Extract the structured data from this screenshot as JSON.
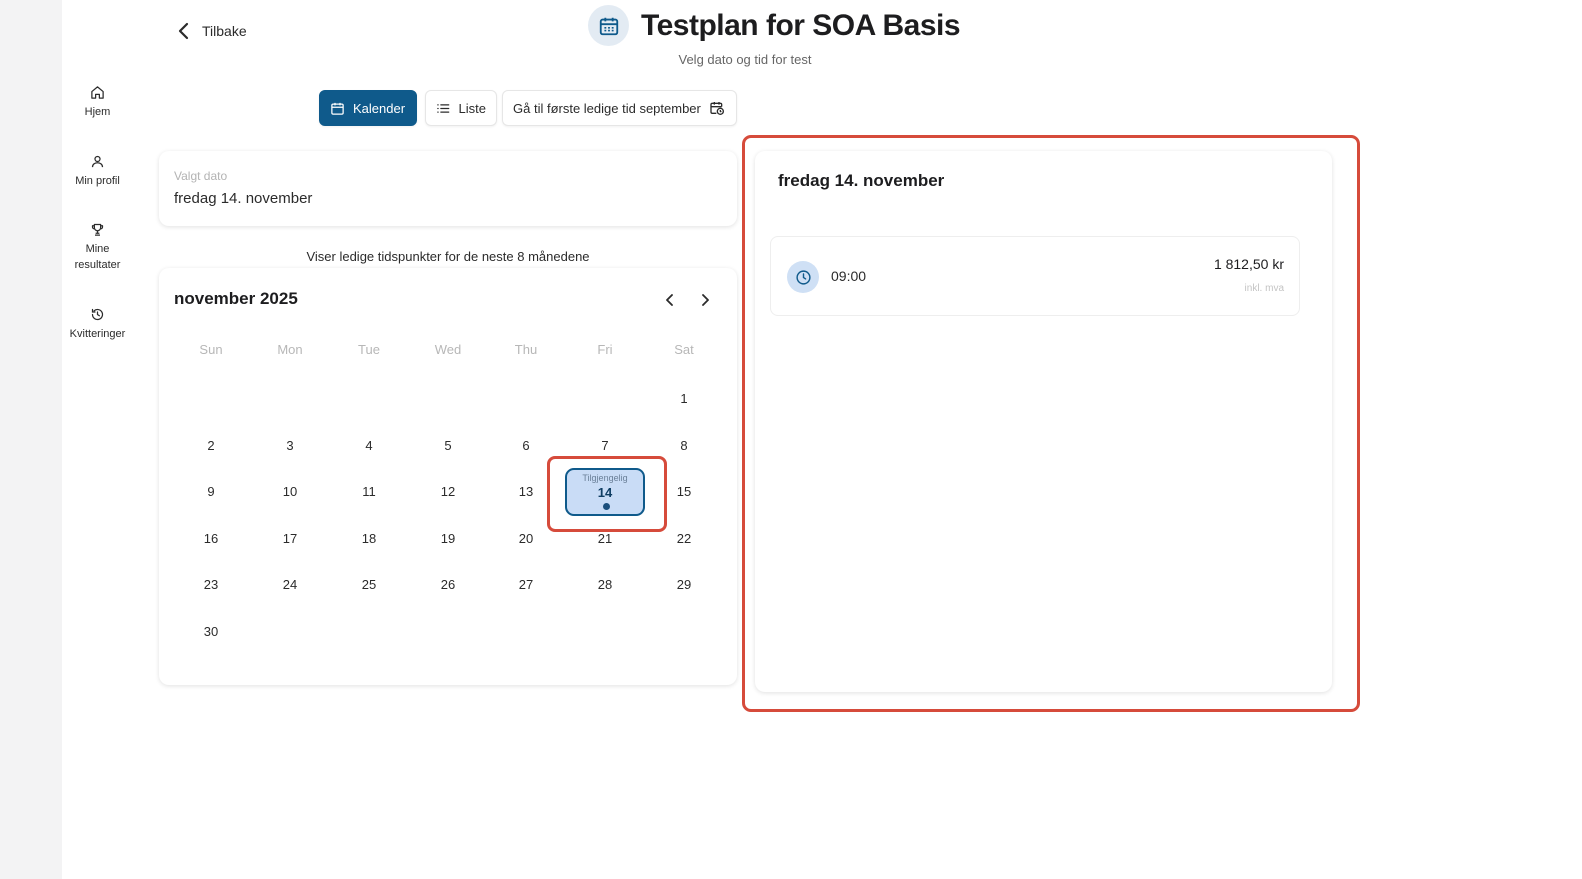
{
  "sidebar": {
    "items": [
      {
        "label": "Hjem",
        "icon": "home-icon"
      },
      {
        "label": "Min profil",
        "icon": "user-icon"
      },
      {
        "label": "Mine resultater",
        "icon": "trophy-icon"
      },
      {
        "label": "Kvitteringer",
        "icon": "history-icon"
      }
    ]
  },
  "header": {
    "back_label": "Tilbake",
    "title": "Testplan for SOA Basis",
    "subtitle": "Velg dato og tid for test"
  },
  "toolbar": {
    "calendar_label": "Kalender",
    "list_label": "Liste",
    "first_available_label": "Gå til første ledige tid september"
  },
  "selected_date": {
    "label": "Valgt dato",
    "value": "fredag 14. november"
  },
  "calendar": {
    "info": "Viser ledige tidspunkter for de neste 8 månedene",
    "month": "november 2025",
    "weekdays": [
      "Sun",
      "Mon",
      "Tue",
      "Wed",
      "Thu",
      "Fri",
      "Sat"
    ],
    "first_weekday_index": 6,
    "days_in_month": 30,
    "selected_day": 14,
    "selected_tag": "Tilgjengelig"
  },
  "slots_panel": {
    "title": "fredag 14. november",
    "slots": [
      {
        "time": "09:00",
        "price": "1 812,50 kr",
        "vat_note": "inkl. mva"
      }
    ]
  },
  "colors": {
    "primary": "#0f5a8b",
    "selected_day_bg": "#c9dcf6",
    "highlight": "#d64b3b"
  }
}
